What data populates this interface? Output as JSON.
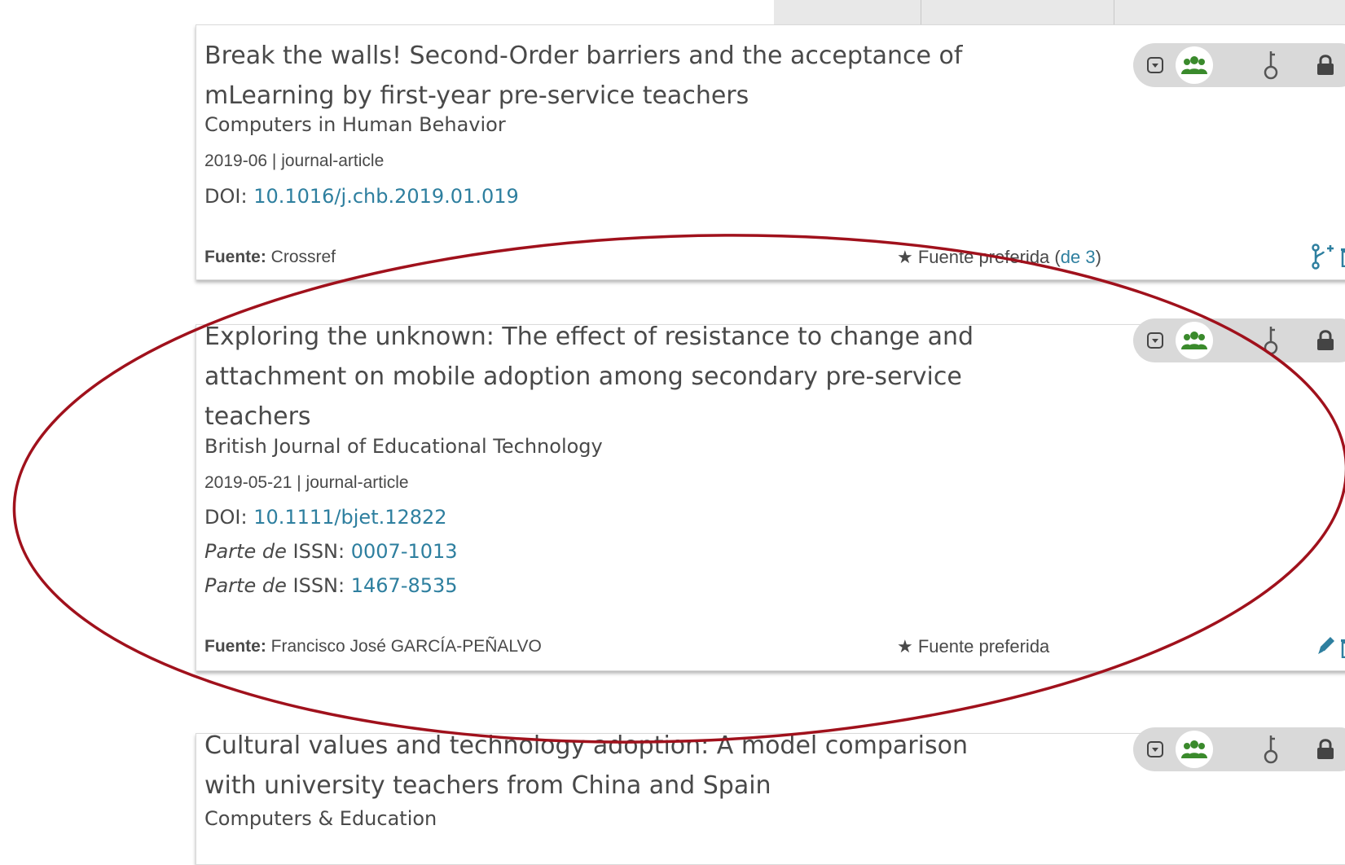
{
  "top_bar": {
    "segments": 3
  },
  "colors": {
    "link": "#2e7f9f",
    "accent_green": "#3a8a2c",
    "annotation": "#a0111c",
    "edit_blue": "#2e7f9f"
  },
  "icons": {
    "privacy_toggle": "dropdown-toggle-icon",
    "everyone": "users-icon",
    "limited": "key-icon",
    "private": "lock-icon",
    "add_source": "branch-plus-icon",
    "edit": "pencil-icon",
    "delete": "trash-icon",
    "preferred": "star-icon"
  },
  "works": [
    {
      "title": "Break the walls! Second-Order barriers and the acceptance of mLearning by first-year pre-service teachers",
      "journal": "Computers in Human Behavior",
      "date_type": "2019-06 | journal-article",
      "doi_label": "DOI:",
      "doi": "10.1016/j.chb.2019.01.019",
      "source_label": "Fuente:",
      "source": "Crossref",
      "preferred": "Fuente preferida",
      "preferred_extra_open": " (",
      "preferred_extra_link": "de 3",
      "preferred_extra_close": ")"
    },
    {
      "title": "Exploring the unknown: The effect of resistance to change and attachment on mobile adoption among secondary pre-service teachers",
      "journal": "British Journal of Educational Technology",
      "date_type": "2019-05-21 | journal-article",
      "doi_label": "DOI:",
      "doi": "10.1111/bjet.12822",
      "issn_prefix": "Parte de",
      "issn_label": "ISSN:",
      "issn_1": "0007-1013",
      "issn_2": "1467-8535",
      "source_label": "Fuente:",
      "source": "Francisco José GARCÍA-PEÑALVO",
      "preferred": "Fuente preferida"
    },
    {
      "title": "Cultural values and technology adoption: A model comparison with university teachers from China and Spain",
      "journal": "Computers & Education"
    }
  ]
}
